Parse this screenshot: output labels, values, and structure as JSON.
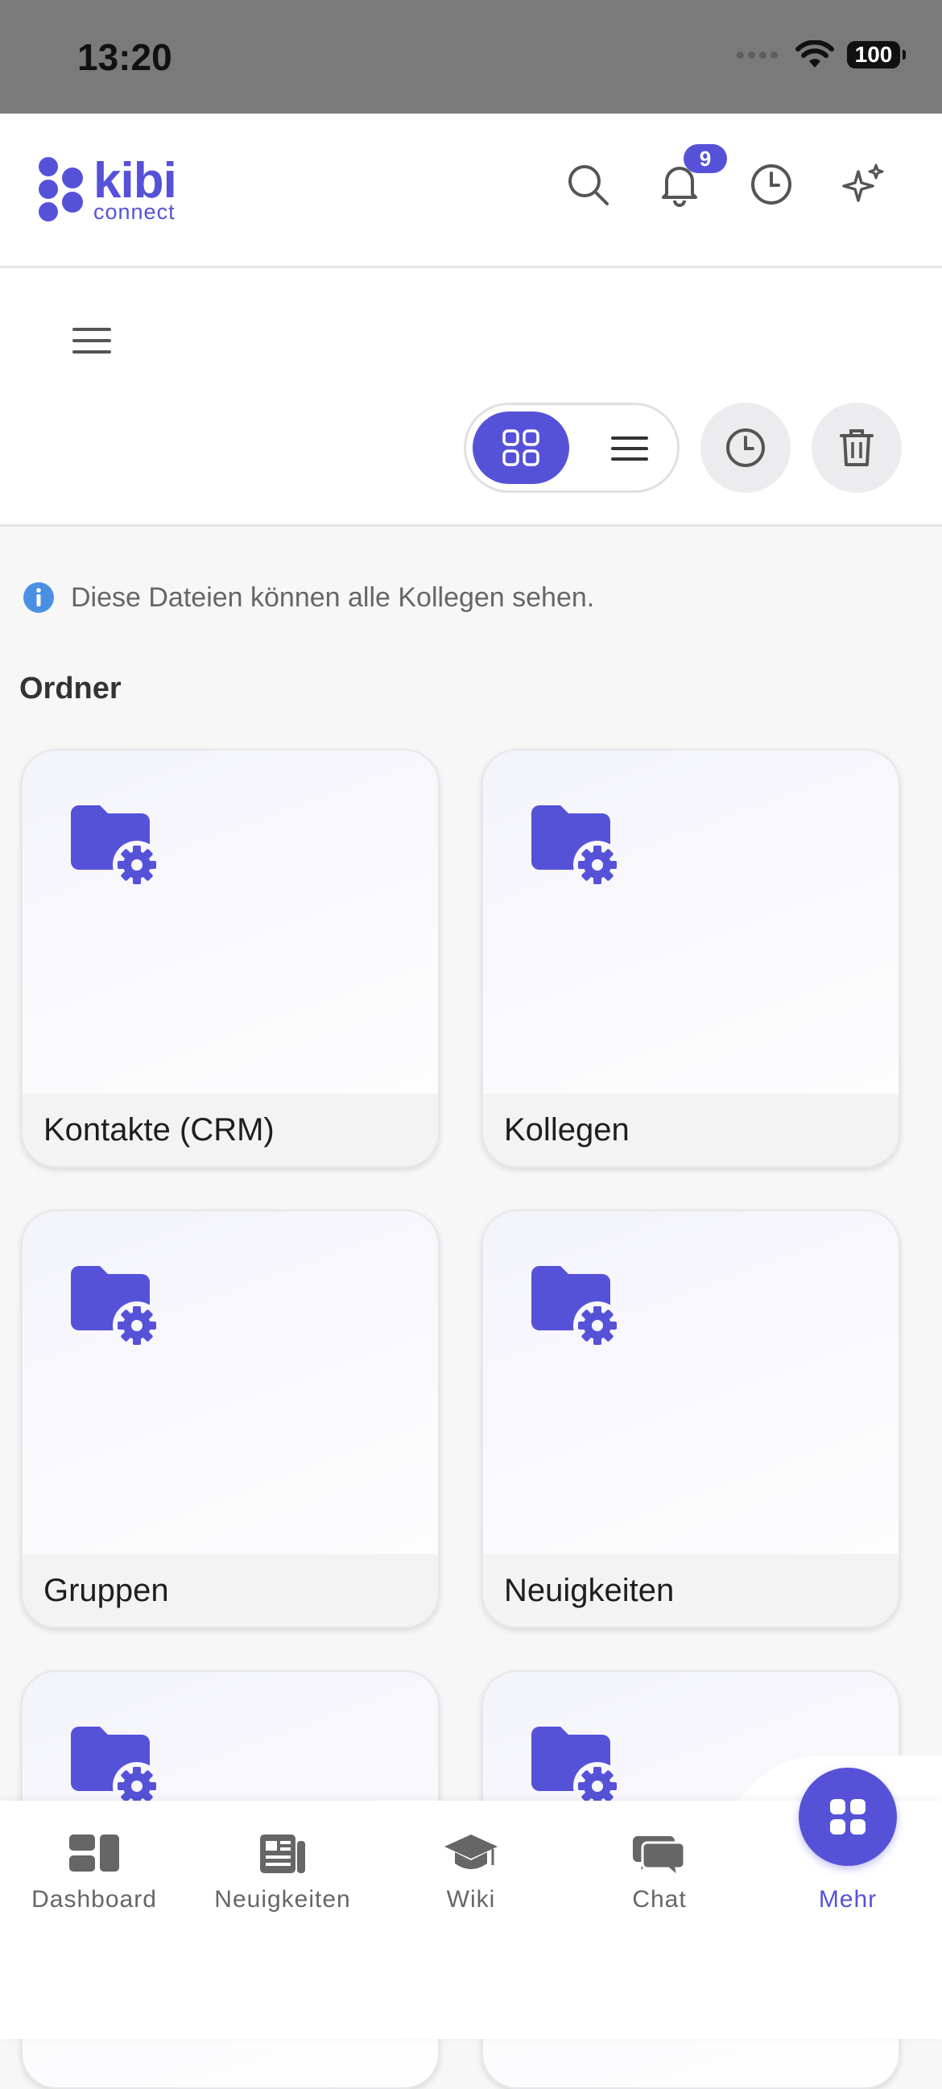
{
  "status_bar": {
    "time": "13:20",
    "battery": "100"
  },
  "header": {
    "logo_main": "kibi",
    "logo_sub": "connect",
    "notification_count": "9"
  },
  "info": {
    "text": "Diese Dateien können alle Kollegen sehen."
  },
  "section": {
    "title": "Ordner"
  },
  "folders": [
    {
      "label": "Kontakte (CRM)",
      "icon": "folder-gear-icon"
    },
    {
      "label": "Kollegen",
      "icon": "folder-gear-icon"
    },
    {
      "label": "Gruppen",
      "icon": "folder-gear-icon"
    },
    {
      "label": "Neuigkeiten",
      "icon": "folder-gear-icon"
    },
    {
      "label": "",
      "icon": "folder-gear-icon"
    },
    {
      "label": "",
      "icon": "folder-gear-icon"
    }
  ],
  "bottom_nav": {
    "items": [
      {
        "label": "Dashboard",
        "icon": "dashboard-icon"
      },
      {
        "label": "Neuigkeiten",
        "icon": "newspaper-icon"
      },
      {
        "label": "Wiki",
        "icon": "graduation-cap-icon"
      },
      {
        "label": "Chat",
        "icon": "chat-bubbles-icon"
      },
      {
        "label": "Mehr",
        "icon": "grid-icon",
        "active": true
      }
    ]
  },
  "colors": {
    "accent": "#5652d8",
    "status_bar": "#7a7a7a"
  }
}
